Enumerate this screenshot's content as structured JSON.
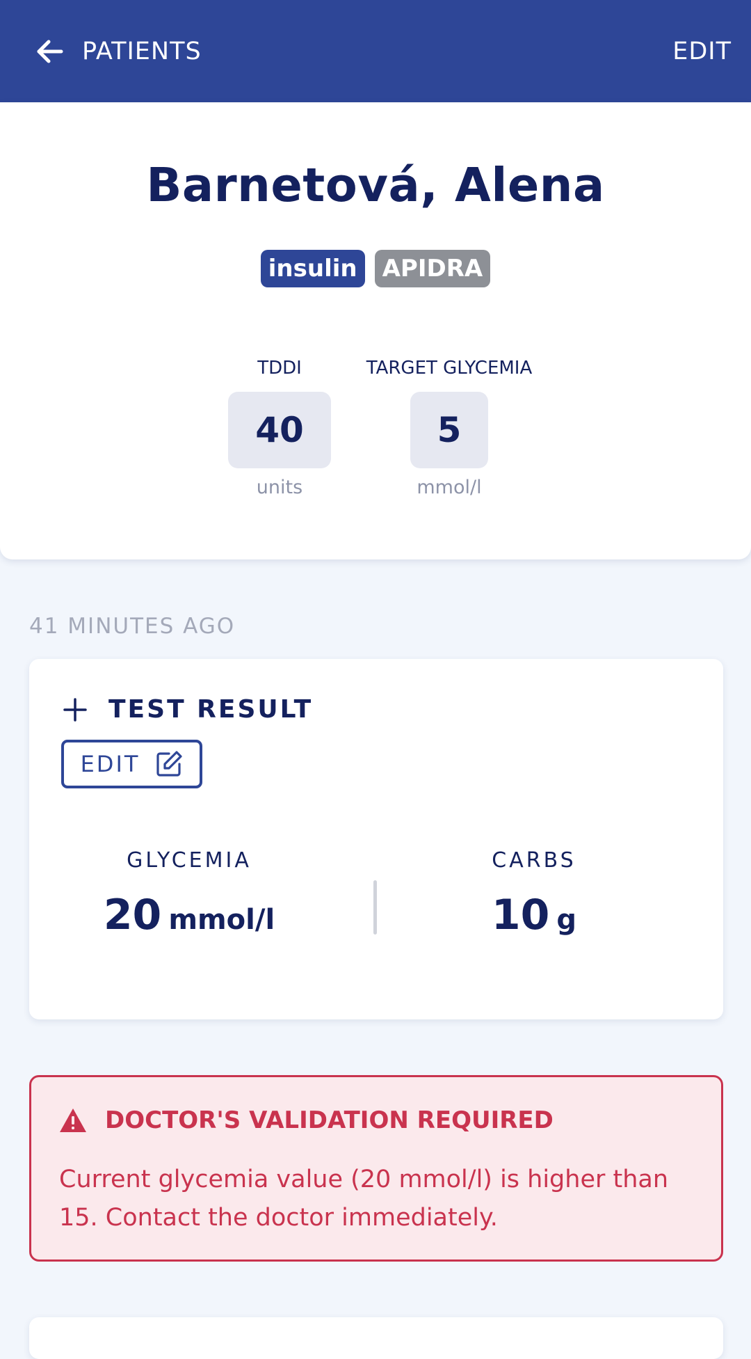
{
  "appbar": {
    "back_label": "PATIENTS",
    "edit_label": "EDIT",
    "color": "#2e4697"
  },
  "patient": {
    "name": "Barnetová, Alena",
    "badges": [
      "insulin",
      "APIDRA"
    ],
    "stats": [
      {
        "label": "TDDI",
        "value": "40",
        "unit": "units"
      },
      {
        "label": "TARGET GLYCEMIA",
        "value": "5",
        "unit": "mmol/l"
      }
    ]
  },
  "entry": {
    "timestamp": "41 MINUTES AGO",
    "title": "TEST RESULT",
    "edit_label": "EDIT",
    "glycemia": {
      "label": "GLYCEMIA",
      "value": "20",
      "unit": "mmol/l"
    },
    "carbs": {
      "label": "CARBS",
      "value": "10",
      "unit": "g"
    }
  },
  "alert": {
    "title": "DOCTOR'S VALIDATION REQUIRED",
    "message": "Current glycemia value (20 mmol/l) is higher than 15. Contact the doctor immediately.",
    "color": "#c9334e"
  },
  "icons": [
    "arrow-left-icon",
    "plus-icon",
    "edit-square-icon",
    "warning-triangle-icon"
  ]
}
